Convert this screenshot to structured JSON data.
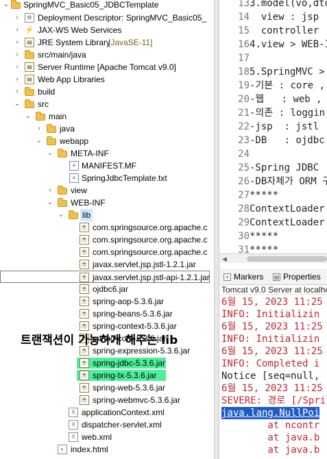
{
  "tree": {
    "project": "SpringMVC_Basic05_JDBCTemplate",
    "deployment": "Deployment Descriptor: SpringMVC_Basic05_",
    "jaxws": "JAX-WS Web Services",
    "jre": "JRE System Library",
    "jre_decor": "[JavaSE-11]",
    "src_main_java": "src/main/java",
    "server_runtime": "Server Runtime [Apache Tomcat v9.0]",
    "web_app_libs": "Web App Libraries",
    "build": "build",
    "src": "src",
    "main": "main",
    "java": "java",
    "webapp": "webapp",
    "meta_inf": "META-INF",
    "manifest": "MANIFEST.MF",
    "springjdbc_txt": "SpringJdbcTemplate.txt",
    "view": "view",
    "web_inf": "WEB-INF",
    "lib": "lib",
    "jars": [
      "com.springsource.org.apache.c",
      "com.springsource.org.apache.c",
      "com.springsource.org.apache.c",
      "javax.servlet.jsp.jstl-1.2.1.jar",
      "javax.servlet.jsp.jstl-api-1.2.1.jar",
      "ojdbc6.jar",
      "spring-aop-5.3.6.jar",
      "spring-beans-5.3.6.jar",
      "spring-context-5.3.6.jar",
      "spring-core-5.3.6.jar",
      "spring-expression-5.3.6.jar",
      "spring-jdbc-5.3.6.jar",
      "spring-tx-5.3.6.jar",
      "spring-web-5.3.6.jar",
      "spring-webmvc-5.3.6.jar"
    ],
    "app_context": "applicationContext.xml",
    "dispatcher": "dispatcher-servlet.xml",
    "web_xml": "web.xml",
    "index": "index.html"
  },
  "overlay_text": "트랜잭션이 가능하게 해주는 lib",
  "editor": {
    "lines": [
      {
        "n": "13",
        "t": "3.model(vo,dto"
      },
      {
        "n": "14",
        "t": "  view : jsp"
      },
      {
        "n": "15",
        "t": "  controller"
      },
      {
        "n": "16",
        "t": "4.view > WEB-I"
      },
      {
        "n": "17",
        "t": ""
      },
      {
        "n": "18",
        "t": "5.SpringMVC >"
      },
      {
        "n": "19",
        "t": "-기본 : core ,"
      },
      {
        "n": "20",
        "t": "-웹   : web ,"
      },
      {
        "n": "21",
        "t": "-의존 : loggin"
      },
      {
        "n": "22",
        "t": "-jsp  : jstl"
      },
      {
        "n": "23",
        "t": "-DB   : ojdbc"
      },
      {
        "n": "24",
        "t": ""
      },
      {
        "n": "25",
        "t": "-Spring JDBC"
      },
      {
        "n": "26",
        "t": "-DB자체가 ORM 구"
      },
      {
        "n": "27",
        "t": "*****"
      },
      {
        "n": "28",
        "t": "ContextLoader"
      },
      {
        "n": "29",
        "t": "ContextLoader"
      },
      {
        "n": "30",
        "t": "*****"
      },
      {
        "n": "31",
        "t": "*****"
      }
    ]
  },
  "tabs": {
    "markers": "Markers",
    "properties": "Properties"
  },
  "console": {
    "title": "Tomcat v9.0 Server at localho",
    "lines": [
      {
        "t": "6월 15, 2023 11:25",
        "c": "red"
      },
      {
        "t": "INFO: Initializin",
        "c": "red"
      },
      {
        "t": "6월 15, 2023 11:25",
        "c": "red"
      },
      {
        "t": "INFO: Initializin",
        "c": "red"
      },
      {
        "t": "6월 15, 2023 11:25",
        "c": "red"
      },
      {
        "t": "INFO: Completed i",
        "c": "red"
      },
      {
        "t": "Notice [seq=null,",
        "c": "blk"
      },
      {
        "t": "6월 15, 2023 11:25",
        "c": "red"
      },
      {
        "t": "SEVERE: 경로 [/Spri",
        "c": "red"
      },
      {
        "t": "java.lang.NullPoi",
        "c": "link"
      },
      {
        "t": "        at ncontr",
        "c": "red"
      },
      {
        "t": "        at java.b",
        "c": "red"
      },
      {
        "t": "        at java.b",
        "c": "red"
      }
    ]
  }
}
